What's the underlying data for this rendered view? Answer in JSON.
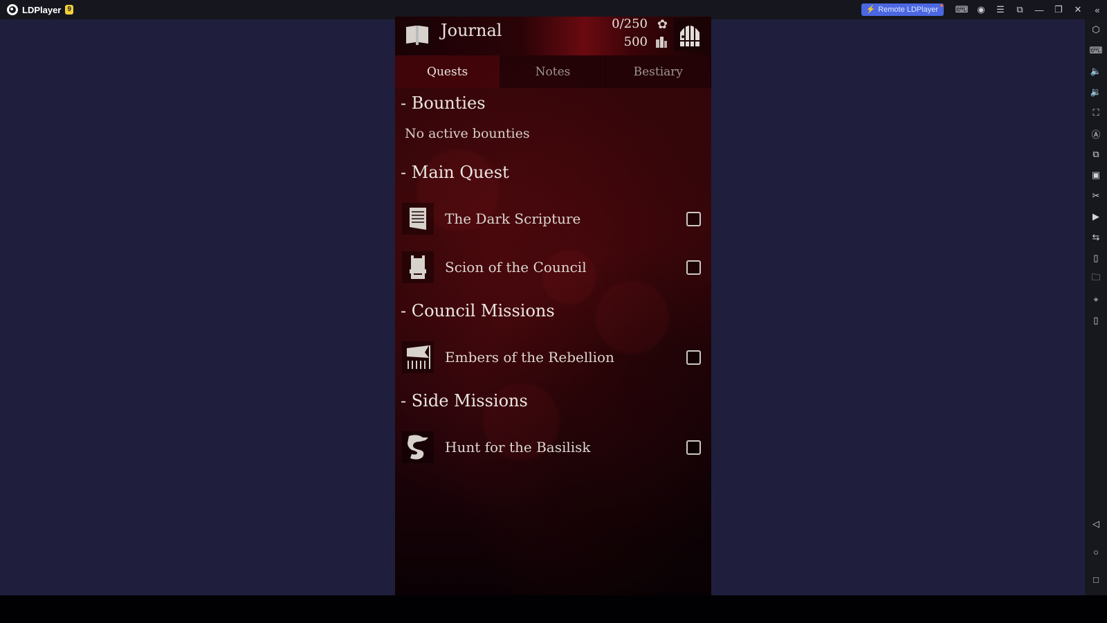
{
  "app": {
    "name": "LDPlayer",
    "version_badge": "9",
    "remote_button": "Remote LDPlayer",
    "titlebar_icons": [
      "gamepad-icon",
      "account-icon",
      "menu-icon",
      "resize-icon",
      "minimize-icon",
      "restore-icon",
      "close-icon",
      "collapse-sidebar-icon"
    ],
    "sidebar_icons": [
      "settings-hex-icon",
      "keyboard-icon",
      "volume-up-icon",
      "volume-down-icon",
      "fullscreen-icon",
      "auto-rotate-icon",
      "multi-instance-icon",
      "apk-install-icon",
      "scissors-icon",
      "video-record-icon",
      "sync-icon",
      "shake-icon",
      "folder-icon",
      "location-icon",
      "rotate-icon"
    ],
    "nav_icons": [
      "back-icon",
      "home-icon",
      "recents-icon"
    ]
  },
  "game": {
    "header": {
      "title": "Journal",
      "stat_primary": "0/250",
      "stat_secondary": "500"
    },
    "tabs": [
      {
        "label": "Quests",
        "active": true
      },
      {
        "label": "Notes",
        "active": false
      },
      {
        "label": "Bestiary",
        "active": false
      }
    ],
    "sections": [
      {
        "title": "- Bounties",
        "empty_message": "No active bounties",
        "quests": []
      },
      {
        "title": "- Main Quest",
        "quests": [
          {
            "label": "The Dark Scripture",
            "icon": "scroll-icon",
            "checked": false
          },
          {
            "label": "Scion of the Council",
            "icon": "throne-icon",
            "checked": false
          }
        ]
      },
      {
        "title": "- Council Missions",
        "quests": [
          {
            "label": "Embers of the Rebellion",
            "icon": "banner-icon",
            "checked": false
          }
        ]
      },
      {
        "title": "- Side Missions",
        "quests": [
          {
            "label": "Hunt for the Basilisk",
            "icon": "serpent-icon",
            "checked": false
          }
        ]
      }
    ]
  }
}
